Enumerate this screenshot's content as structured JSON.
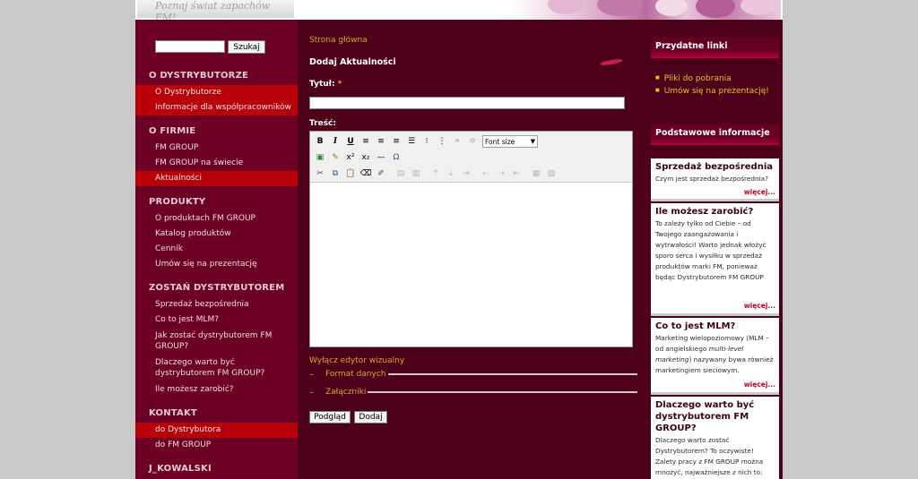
{
  "header": {
    "slogan": "Poznaj świat zapachów FM!"
  },
  "colors": {
    "page_bg": "#4d0019",
    "sidebar_bg": "#6d0025",
    "active_item": "#b8000a",
    "link_gold": "#e0a630",
    "right_link": "#f0c020"
  },
  "search": {
    "value": "",
    "button_label": "Szukaj"
  },
  "sidebar": {
    "sections": [
      {
        "title": "O DYSTRYBUTORZE",
        "items": [
          {
            "label": "O Dystrybutorze",
            "active": true
          },
          {
            "label": "Informacje dla współpracowników",
            "active": true
          }
        ]
      },
      {
        "title": "O FIRMIE",
        "items": [
          {
            "label": "FM GROUP",
            "active": false
          },
          {
            "label": "FM GROUP na świecie",
            "active": false
          },
          {
            "label": "Aktualności",
            "active": true
          }
        ]
      },
      {
        "title": "PRODUKTY",
        "items": [
          {
            "label": "O produktach FM GROUP",
            "active": false
          },
          {
            "label": "Katalog produktów",
            "active": false
          },
          {
            "label": "Cennik",
            "active": false
          },
          {
            "label": "Umów się na prezentację",
            "active": false
          }
        ]
      },
      {
        "title": "ZOSTAŃ DYSTRYBUTOREM",
        "items": [
          {
            "label": "Sprzedaż bezpośrednia",
            "active": false
          },
          {
            "label": "Co to jest MLM?",
            "active": false
          },
          {
            "label": "Jak zostać dystrybutorem FM GROUP?",
            "active": false
          },
          {
            "label": "Dlaczego warto być dystrybutorem FM GROUP?",
            "active": false
          },
          {
            "label": "Ile możesz zarobić?",
            "active": false
          }
        ]
      },
      {
        "title": "KONTAKT",
        "items": [
          {
            "label": "do Dystrybutora",
            "active": true
          },
          {
            "label": "do FM GROUP",
            "active": false
          }
        ]
      },
      {
        "title": "J_KOWALSKI",
        "items": []
      }
    ]
  },
  "content": {
    "breadcrumb": "Strona główna",
    "title": "Dodaj Aktualności",
    "title_label": "Tytuł:",
    "required_mark": "*",
    "title_value": "",
    "body_label": "Treść:",
    "editor": {
      "font_select": "Font size",
      "body_value": ""
    },
    "toggle_editor": "Wyłącz edytor wizualny",
    "fieldsets": [
      {
        "symbol": "–",
        "title": "Format danych"
      },
      {
        "symbol": "–",
        "title": "Załączniki"
      }
    ],
    "preview_button": "Podgląd",
    "add_button": "Dodaj"
  },
  "right": {
    "useful_links_title": "Przydatne linki",
    "links": [
      "Pliki do pobrania",
      "Umów się na prezentację!"
    ],
    "basic_info_title": "Podstawowe informacje",
    "boxes": [
      {
        "title": "Sprzedaż bezpośrednia",
        "text": "Czym jest sprzedaż bezpośrednia?",
        "more": "więcej..."
      },
      {
        "title": "Ile możesz zarobić?",
        "text": "To zależy tylko od Ciebie – od Twojego zaangażowania i wytrwałości! Warto jednak włożyć sporo serca i wysiłku w sprzedaż produktów marki FM, ponieważ będąc Dystrybutorem FM GROUP",
        "more": "więcej..."
      },
      {
        "title": "Co to jest MLM?",
        "text": "Marketing wielopoziomowy (MLM – od angielskiego",
        "text_italic": "multi-level marketing",
        "text_after": ") nazywany bywa również marketingiem sieciowym.",
        "more": "więcej..."
      },
      {
        "title": "Dlaczego warto być dystrybutorem FM GROUP?",
        "text": "Dlaczego warto zostać Dystrybutorem? To oczywiste! Zalety pracy z FM GROUP można mnożyć, najważniejsze z nich to:",
        "more": ""
      }
    ]
  }
}
